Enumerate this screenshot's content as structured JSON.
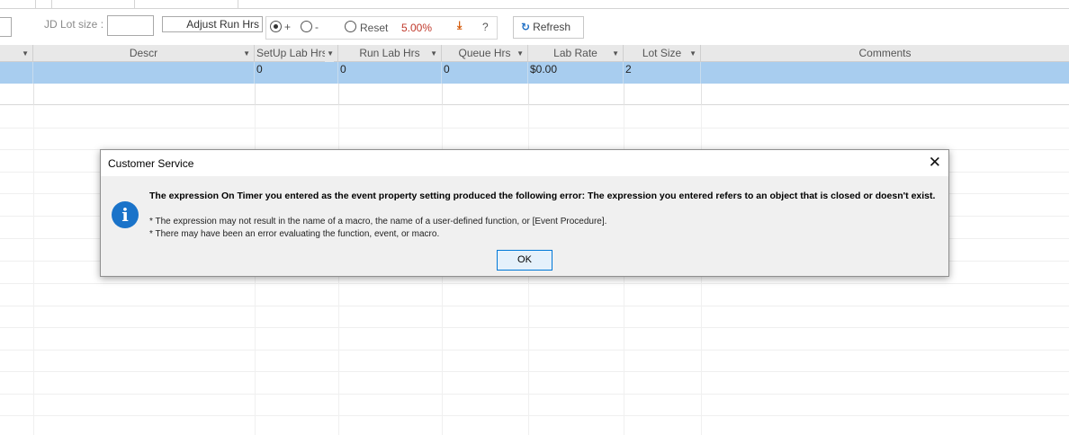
{
  "toolbar": {
    "jd_lot_size_label": "JD Lot size :",
    "adjust_run_hrs_label": "Adjust Run Hrs",
    "plus_label": "+",
    "minus_label": "-",
    "reset_label": "Reset",
    "percent_value": "5.00%",
    "help_label": "?",
    "refresh_label": "Refresh"
  },
  "grid": {
    "columns": [
      "Descr",
      "SetUp Lab Hrs",
      "Run Lab Hrs",
      "Queue Hrs",
      "Lab Rate",
      "Lot Size",
      "Comments"
    ],
    "selected_row": {
      "setup_lab_hrs": "0",
      "run_lab_hrs": "0",
      "queue_hrs": "0",
      "lab_rate": "$0.00",
      "lot_size": "2"
    }
  },
  "dialog": {
    "title": "Customer Service",
    "close_glyph": "✕",
    "message_main": "The expression On Timer you entered as the event property setting produced the following error: The expression you entered refers to an object that is closed or doesn't exist.",
    "message_bullets": [
      "* The expression may not result in the name of a macro, the name of a user-defined function, or [Event Procedure].",
      "* There may have been an error evaluating the function, event, or macro."
    ],
    "ok_label": "OK"
  },
  "icons": {
    "info": "info-icon",
    "refresh": "refresh-icon",
    "download": "download-icon",
    "dropdown": "chevron-down-icon",
    "close": "close-icon"
  },
  "colors": {
    "selected_row": "#a8cdef",
    "header_bg": "#e8e8e8",
    "percent": "#c0392b",
    "info_icon": "#1a73c9",
    "ok_border": "#0078d7"
  }
}
